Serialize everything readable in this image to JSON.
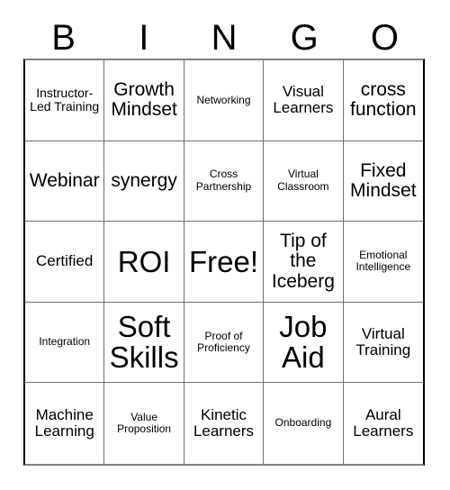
{
  "card": {
    "title": "BINGO Card",
    "header_letters": [
      "B",
      "I",
      "N",
      "G",
      "O"
    ],
    "grid_size": "5x5",
    "colors": {
      "background": "#ffffff",
      "text": "#000000",
      "grid_line": "#707070",
      "outer_border": "#000000"
    },
    "rows": [
      [
        {
          "text": "Instructor-Led Training",
          "size": "fs-sm"
        },
        {
          "text": "Growth Mindset",
          "size": "fs-lg"
        },
        {
          "text": "Networking",
          "size": "fs-xs"
        },
        {
          "text": "Visual Learners",
          "size": "fs-md"
        },
        {
          "text": "cross function",
          "size": "fs-lg"
        }
      ],
      [
        {
          "text": "Webinar",
          "size": "fs-lg"
        },
        {
          "text": "synergy",
          "size": "fs-lg"
        },
        {
          "text": "Cross Partnership",
          "size": "fs-xs"
        },
        {
          "text": "Virtual Classroom",
          "size": "fs-xs"
        },
        {
          "text": "Fixed Mindset",
          "size": "fs-lg"
        }
      ],
      [
        {
          "text": "Certified",
          "size": "fs-md"
        },
        {
          "text": "ROI",
          "size": "fs-xxl"
        },
        {
          "text": "Free!",
          "size": "fs-xxl"
        },
        {
          "text": "Tip of the Iceberg",
          "size": "fs-lg"
        },
        {
          "text": "Emotional Intelligence",
          "size": "fs-xs"
        }
      ],
      [
        {
          "text": "Integration",
          "size": "fs-xs"
        },
        {
          "text": "Soft Skills",
          "size": "fs-xxl"
        },
        {
          "text": "Proof of Proficiency",
          "size": "fs-xs"
        },
        {
          "text": "Job Aid",
          "size": "fs-xxl"
        },
        {
          "text": "Virtual Training",
          "size": "fs-md"
        }
      ],
      [
        {
          "text": "Machine Learning",
          "size": "fs-md"
        },
        {
          "text": "Value Proposition",
          "size": "fs-xs"
        },
        {
          "text": "Kinetic Learners",
          "size": "fs-md"
        },
        {
          "text": "Onboarding",
          "size": "fs-xs"
        },
        {
          "text": "Aural Learners",
          "size": "fs-md"
        }
      ]
    ]
  }
}
